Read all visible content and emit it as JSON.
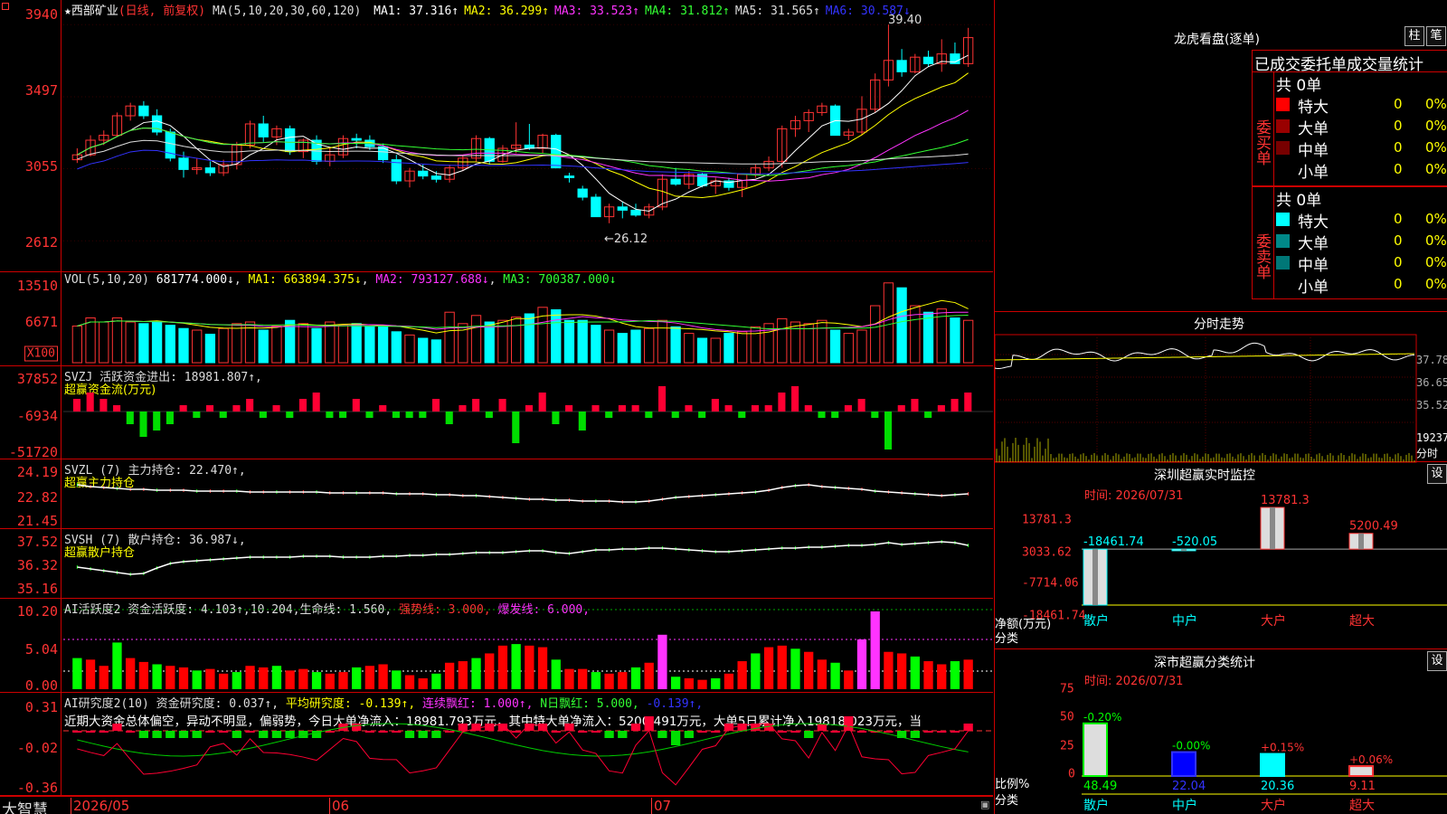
{
  "app": {
    "logo": "大智慧"
  },
  "kline": {
    "title": "★西部矿业",
    "mode": "(日线, 前复权)",
    "ma_label": "MA(5,10,20,30,60,120)",
    "ma_values": [
      {
        "t": "MA1:",
        "v": "37.316↑",
        "c": "#fff"
      },
      {
        "t": "MA2:",
        "v": "36.299↑",
        "c": "#ff0"
      },
      {
        "t": "MA3:",
        "v": "33.523↑",
        "c": "#f3f"
      },
      {
        "t": "MA4:",
        "v": "31.812↑",
        "c": "#3f3"
      },
      {
        "t": "MA5:",
        "v": "31.565↑",
        "c": "#ddd"
      },
      {
        "t": "MA6:",
        "v": "30.587↓",
        "c": "#33f"
      }
    ],
    "yticks": [
      "3940",
      "3497",
      "3055",
      "2612"
    ],
    "high_label": "39.40",
    "low_label": "26.12",
    "ylim": [
      2480,
      3980
    ],
    "candles": [
      [
        3110,
        3180,
        3090,
        3140
      ],
      [
        3140,
        3260,
        3130,
        3230
      ],
      [
        3230,
        3290,
        3200,
        3260
      ],
      [
        3260,
        3400,
        3250,
        3380
      ],
      [
        3380,
        3460,
        3350,
        3440
      ],
      [
        3440,
        3470,
        3360,
        3380
      ],
      [
        3380,
        3420,
        3260,
        3280
      ],
      [
        3280,
        3300,
        3100,
        3120
      ],
      [
        3120,
        3160,
        3000,
        3050
      ],
      [
        3050,
        3120,
        3020,
        3060
      ],
      [
        3060,
        3100,
        3010,
        3030
      ],
      [
        3030,
        3110,
        3010,
        3080
      ],
      [
        3080,
        3220,
        3050,
        3200
      ],
      [
        3200,
        3350,
        3180,
        3330
      ],
      [
        3330,
        3380,
        3220,
        3250
      ],
      [
        3250,
        3320,
        3200,
        3300
      ],
      [
        3300,
        3320,
        3140,
        3160
      ],
      [
        3160,
        3240,
        3120,
        3230
      ],
      [
        3230,
        3260,
        3080,
        3100
      ],
      [
        3100,
        3180,
        3070,
        3140
      ],
      [
        3140,
        3260,
        3120,
        3240
      ],
      [
        3240,
        3270,
        3180,
        3230
      ],
      [
        3230,
        3260,
        3170,
        3190
      ],
      [
        3190,
        3210,
        3090,
        3110
      ],
      [
        3110,
        3140,
        2960,
        2980
      ],
      [
        2980,
        3060,
        2940,
        3040
      ],
      [
        3040,
        3080,
        2990,
        3010
      ],
      [
        3010,
        3040,
        2970,
        2990
      ],
      [
        2990,
        3080,
        2970,
        3060
      ],
      [
        3060,
        3140,
        3040,
        3120
      ],
      [
        3120,
        3260,
        3100,
        3240
      ],
      [
        3240,
        3250,
        3080,
        3100
      ],
      [
        3100,
        3200,
        3090,
        3180
      ],
      [
        3180,
        3340,
        3150,
        3200
      ],
      [
        3200,
        3330,
        3170,
        3180
      ],
      [
        3180,
        3270,
        3150,
        3260
      ],
      [
        3260,
        3270,
        3060,
        3060
      ],
      [
        3010,
        3030,
        2970,
        3000
      ],
      [
        2930,
        2950,
        2860,
        2880
      ],
      [
        2880,
        2900,
        2760,
        2760
      ],
      [
        2760,
        2840,
        2720,
        2820
      ],
      [
        2820,
        2850,
        2750,
        2800
      ],
      [
        2800,
        2840,
        2760,
        2770
      ],
      [
        2770,
        2840,
        2750,
        2820
      ],
      [
        2820,
        3020,
        2800,
        2990
      ],
      [
        2990,
        3060,
        2950,
        2960
      ],
      [
        2960,
        3040,
        2930,
        3020
      ],
      [
        3020,
        3030,
        2940,
        2950
      ],
      [
        2950,
        3000,
        2900,
        2980
      ],
      [
        2980,
        3000,
        2920,
        2940
      ],
      [
        2940,
        2980,
        2880,
        3020
      ],
      [
        3020,
        3080,
        3000,
        3060
      ],
      [
        3060,
        3130,
        3040,
        3100
      ],
      [
        3100,
        3320,
        3060,
        3300
      ],
      [
        3300,
        3380,
        3250,
        3350
      ],
      [
        3350,
        3420,
        3280,
        3400
      ],
      [
        3400,
        3460,
        3380,
        3440
      ],
      [
        3440,
        3450,
        3260,
        3260
      ],
      [
        3260,
        3300,
        3230,
        3280
      ],
      [
        3280,
        3500,
        3260,
        3420
      ],
      [
        3420,
        3640,
        3400,
        3600
      ],
      [
        3600,
        3940,
        3560,
        3720
      ],
      [
        3720,
        3790,
        3620,
        3650
      ],
      [
        3650,
        3760,
        3640,
        3740
      ],
      [
        3740,
        3780,
        3680,
        3700
      ],
      [
        3700,
        3850,
        3650,
        3760
      ],
      [
        3760,
        3830,
        3700,
        3700
      ],
      [
        3700,
        3920,
        3680,
        3860
      ]
    ]
  },
  "volume": {
    "label": "VOL(5,10,20)",
    "v": "681774.000↓",
    "ma1": "MA1: 663894.375↓",
    "ma2": "MA2: 793127.688↓",
    "ma3": "MA3: 700387.000↓",
    "yticks": [
      "13510",
      "6671"
    ],
    "unit": "X100"
  },
  "svzj": {
    "label": "SVZJ  活跃资金进出: 18981.807↑,",
    "sub": "超赢资金流(万元)",
    "yticks": [
      "37852",
      "-6934",
      "-51720"
    ]
  },
  "svzl": {
    "label": "SVZL (7) 主力持仓: 22.470↑,",
    "sub": "超赢主力持仓",
    "yticks": [
      "24.19",
      "22.82",
      "21.45"
    ]
  },
  "svsh": {
    "label": "SVSH (7) 散户持仓: 36.987↓,",
    "sub": "超赢散户持仓",
    "yticks": [
      "37.52",
      "36.32",
      "35.16"
    ]
  },
  "ai1": {
    "label": "AI活跃度2 资金活跃度: 4.103↑,10.204,生命线: 1.560,",
    "strong": "强势线: 3.000,",
    "burst": "爆发线: 6.000,",
    "yticks": [
      "10.20",
      "5.04",
      "0.00"
    ]
  },
  "ai2": {
    "label": "AI研究度2(10) 资金研究度: 0.037↑,",
    "avg": "平均研究度: -0.139↑,",
    "red": "连续飘红: 1.000↑,",
    "nred": "N日飘红: 5.000,",
    "last": "-0.139↑,",
    "text": "近期大资金总体偏空，异动不明显，偏弱势，今日大单净流入：18981.793万元，其中特大单净流入：5200.491万元，大单5日累计净入19818.023万元，当",
    "yticks": [
      "0.31",
      "-0.02",
      "-0.36"
    ]
  },
  "xaxis": [
    "2026/05",
    "06",
    "07"
  ],
  "dragon": {
    "title": "龙虎看盘(逐单)",
    "btn1": "柱",
    "btn2": "笔",
    "head": "已成交委托单成交量统计",
    "buy": "委买单",
    "sell": "委卖单",
    "total_buy": "共 0单",
    "total_sell": "共 0单",
    "buy_rows": [
      {
        "n": "特大",
        "v": "0",
        "p": "0%",
        "c": "#f00"
      },
      {
        "n": "大单",
        "v": "0",
        "p": "0%",
        "c": "#900"
      },
      {
        "n": "中单",
        "v": "0",
        "p": "0%",
        "c": "#700"
      },
      {
        "n": "小单",
        "v": "0",
        "p": "0%",
        "c": "#000"
      }
    ],
    "sell_rows": [
      {
        "n": "特大",
        "v": "0",
        "p": "0%",
        "c": "#0ff"
      },
      {
        "n": "大单",
        "v": "0",
        "p": "0%",
        "c": "#088"
      },
      {
        "n": "中单",
        "v": "0",
        "p": "0%",
        "c": "#077"
      },
      {
        "n": "小单",
        "v": "0",
        "p": "0%",
        "c": "#000"
      }
    ]
  },
  "fenshi": {
    "title": "分时走势",
    "yticks": [
      "37.78",
      "36.65",
      "35.52",
      "19237"
    ],
    "unit": "分时"
  },
  "monitor": {
    "title": "深圳超赢实时监控",
    "btn": "设",
    "time": "时间: 2026/07/31",
    "yticks": [
      "13781.3",
      "3033.62",
      "-7714.06",
      "-18461.74"
    ],
    "ylabel": "净额(万元)",
    "xlabel": "分类",
    "bars": [
      {
        "cat": "散户",
        "label": "-18461.74",
        "value": -18461.74
      },
      {
        "cat": "中户",
        "label": "-520.05",
        "value": -520.05
      },
      {
        "cat": "大户",
        "label": "13781.3",
        "value": 13781.3
      },
      {
        "cat": "超大",
        "label": "5200.49",
        "value": 5200.49
      }
    ]
  },
  "classify": {
    "title": "深市超赢分类统计",
    "btn": "设",
    "time": "时间: 2026/07/31",
    "yticks": [
      "75",
      "50",
      "25",
      "0"
    ],
    "ylabel": "比例%",
    "xlabel": "分类",
    "bars": [
      {
        "cat": "散户",
        "top": "-0.20%",
        "bot": "48.49",
        "value": 48.49
      },
      {
        "cat": "中户",
        "top": "-0.00%",
        "bot": "22.04",
        "value": 22.04
      },
      {
        "cat": "大户",
        "top": "+0.15%",
        "bot": "20.36",
        "value": 20.36
      },
      {
        "cat": "超大",
        "top": "+0.06%",
        "bot": "9.11",
        "value": 9.11
      }
    ]
  }
}
